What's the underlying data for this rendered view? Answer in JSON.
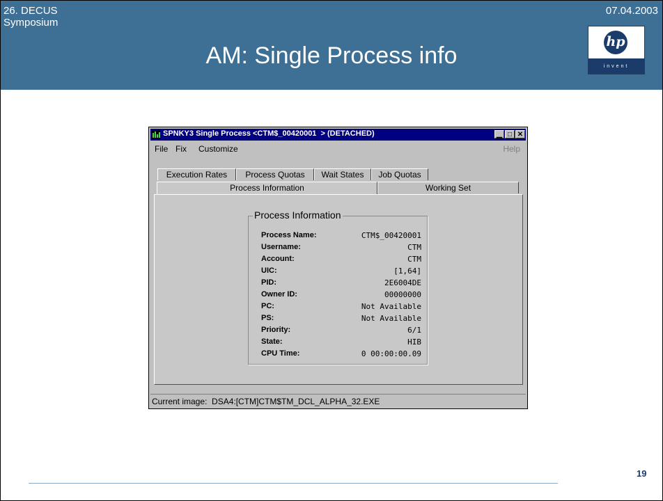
{
  "slide": {
    "conference": "26. DECUS\nSymposium",
    "date": "07.04.2003",
    "title": "AM: Single Process info",
    "page_number": "19"
  },
  "logo": {
    "mark": "hp",
    "tagline": "invent",
    "brand_color": "#1b3b6b"
  },
  "colors": {
    "header": "#3e6f95",
    "titlebar": "#000080",
    "window": "#c0c0c0"
  },
  "window": {
    "title": "SPNKY3 Single Process <CTM$_00420001  > (DETACHED)",
    "controls": {
      "minimize": "▁",
      "maximize": "□",
      "close": "✕"
    },
    "menu": {
      "file": "File",
      "fix": "Fix",
      "customize": "Customize",
      "help": "Help"
    },
    "tabs_back": [
      "Execution Rates",
      "Process Quotas",
      "Wait States",
      "Job Quotas"
    ],
    "tabs_front": {
      "active": "Process Information",
      "other": "Working Set"
    },
    "group_title": "Process Information",
    "fields": [
      {
        "label": "Process Name:",
        "value": "CTM$_00420001"
      },
      {
        "label": "Username:",
        "value": "CTM"
      },
      {
        "label": "Account:",
        "value": "CTM"
      },
      {
        "label": "UIC:",
        "value": "[1,64]"
      },
      {
        "label": "PID:",
        "value": "2E6004DE"
      },
      {
        "label": "Owner ID:",
        "value": "00000000"
      },
      {
        "label": "PC:",
        "value": "Not Available"
      },
      {
        "label": "PS:",
        "value": "Not Available"
      },
      {
        "label": "Priority:",
        "value": "6/1"
      },
      {
        "label": "State:",
        "value": "HIB"
      },
      {
        "label": "CPU Time:",
        "value": "0 00:00:00.09"
      }
    ],
    "status": "Current image:  DSA4:[CTM]CTM$TM_DCL_ALPHA_32.EXE"
  }
}
